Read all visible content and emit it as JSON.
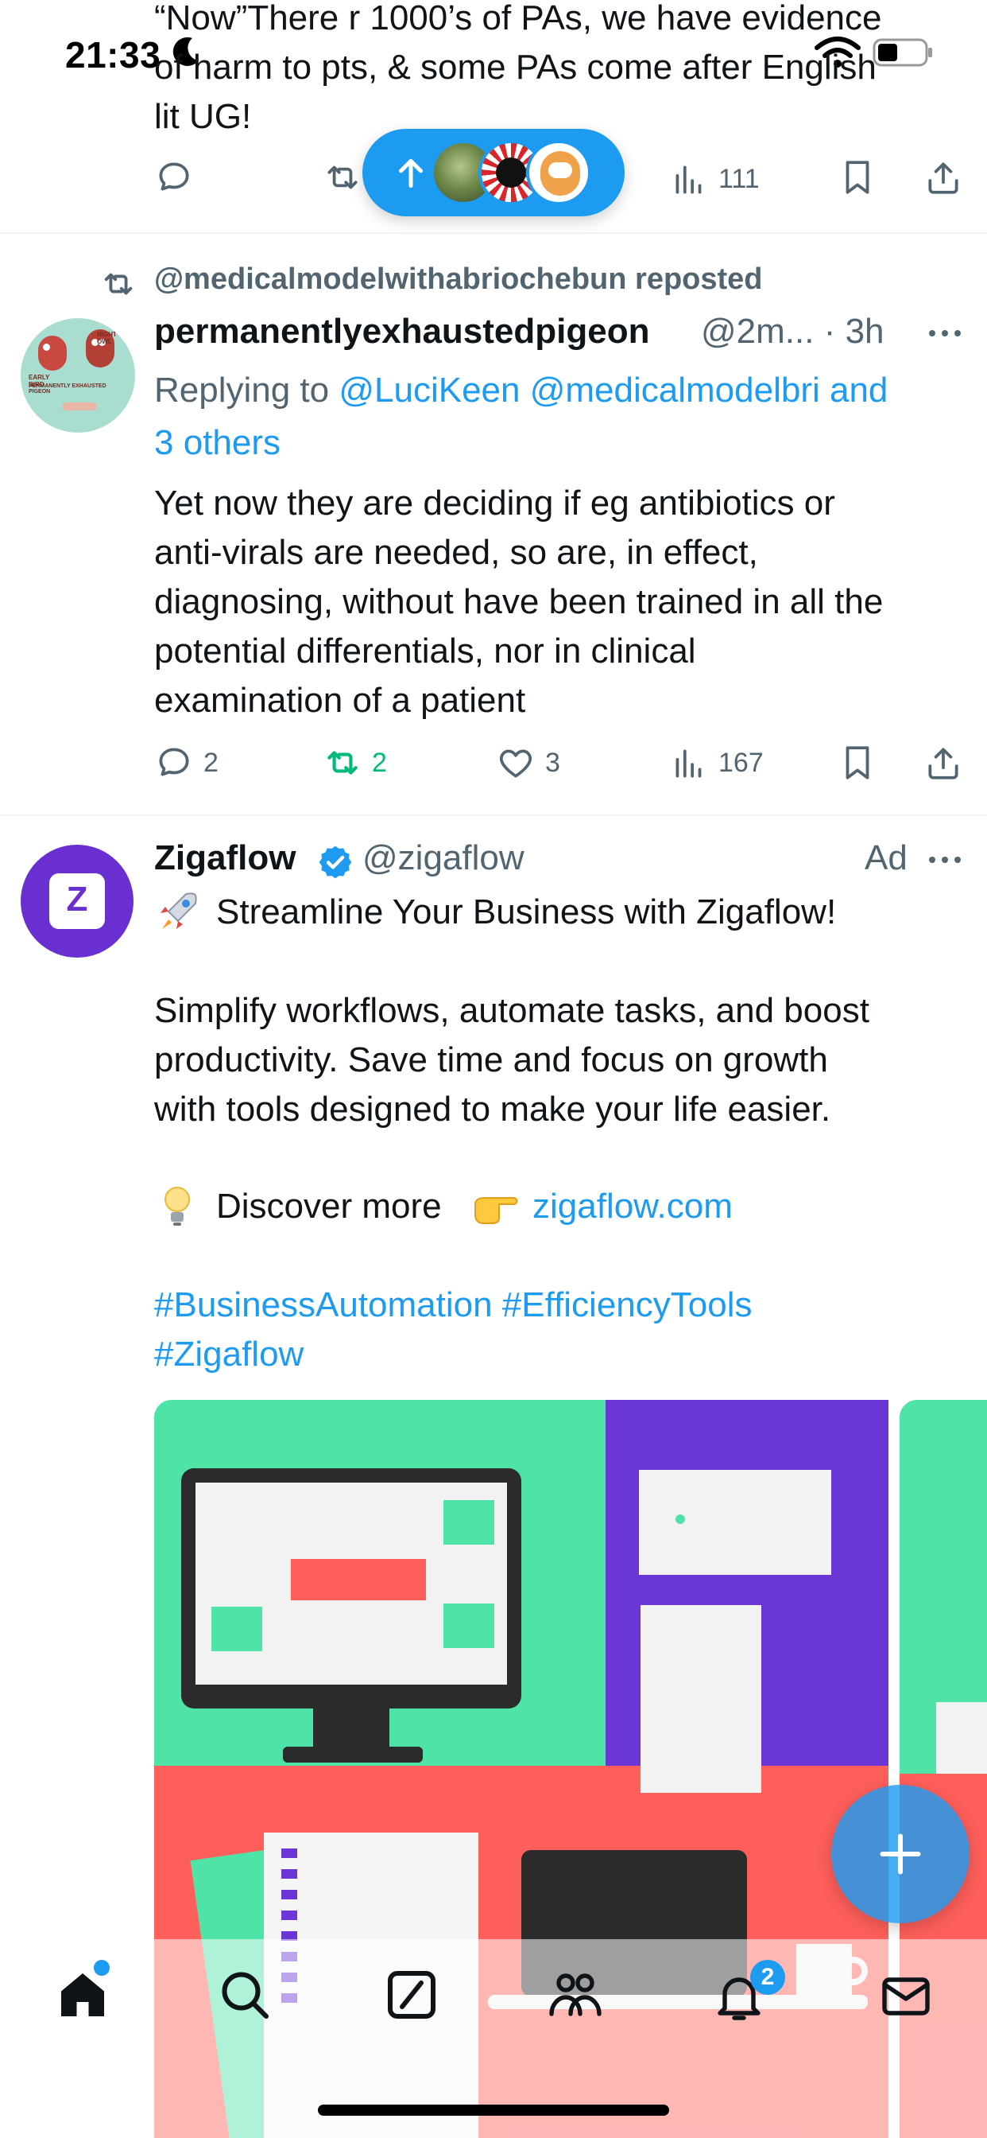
{
  "status_bar": {
    "time": "21:33"
  },
  "top_tweet": {
    "body_line1": "“Now”There r 1000’s of PAs, we have evidence",
    "body_line2": "of harm to pts, & some PAs come after English",
    "body_line3": "lit UG!",
    "views": "111"
  },
  "new_posts_pill": {
    "icon": "arrow-up-icon"
  },
  "repost_tweet": {
    "repost_label": "@medicalmodelwithabriochebun reposted",
    "display_name": "permanentlyexhaustedpigeon",
    "handle_time": "@2m... · 3h",
    "replying_to_prefix": "Replying to ",
    "replying_to_links": "@LuciKeen @medicalmodelbri and",
    "replying_to_links2": "3 others",
    "avatar_texts": [
      "NIGHT OWL",
      "EARLY BIRD",
      "PERMANENTLY EXHAUSTED PIGEON"
    ],
    "body": [
      "Yet now they are deciding if eg antibiotics or",
      "anti-virals are needed, so are, in effect,",
      "diagnosing, without have been trained in all the",
      "potential differentials, nor in clinical",
      "examination of a patient"
    ],
    "replies": "2",
    "reposts": "2",
    "likes": "3",
    "views": "167"
  },
  "ad_tweet": {
    "avatar_letter": "Z",
    "display_name": "Zigaflow",
    "handle": "@zigaflow",
    "ad_label": "Ad",
    "headline": "Streamline Your Business with Zigaflow!",
    "para1": [
      "Simplify workflows, automate tasks, and boost",
      "productivity. Save time and focus on growth",
      "with tools designed to make your life easier."
    ],
    "discover_text": "Discover more",
    "discover_link": "zigaflow.com",
    "hashtags_line1": "#BusinessAutomation #EfficiencyTools",
    "hashtags_line2": "#Zigaflow"
  },
  "bottom_nav": {
    "items": [
      "home-icon",
      "search-icon",
      "grok-icon",
      "communities-icon",
      "notifications-icon",
      "messages-icon"
    ],
    "notifications_badge": "2"
  },
  "colors": {
    "accent": "#1d9bf0",
    "repost_green": "#00ba7c",
    "ad_mint": "#4fe3a7",
    "ad_purple": "#6a37d6",
    "ad_coral": "#ff5f5a"
  }
}
